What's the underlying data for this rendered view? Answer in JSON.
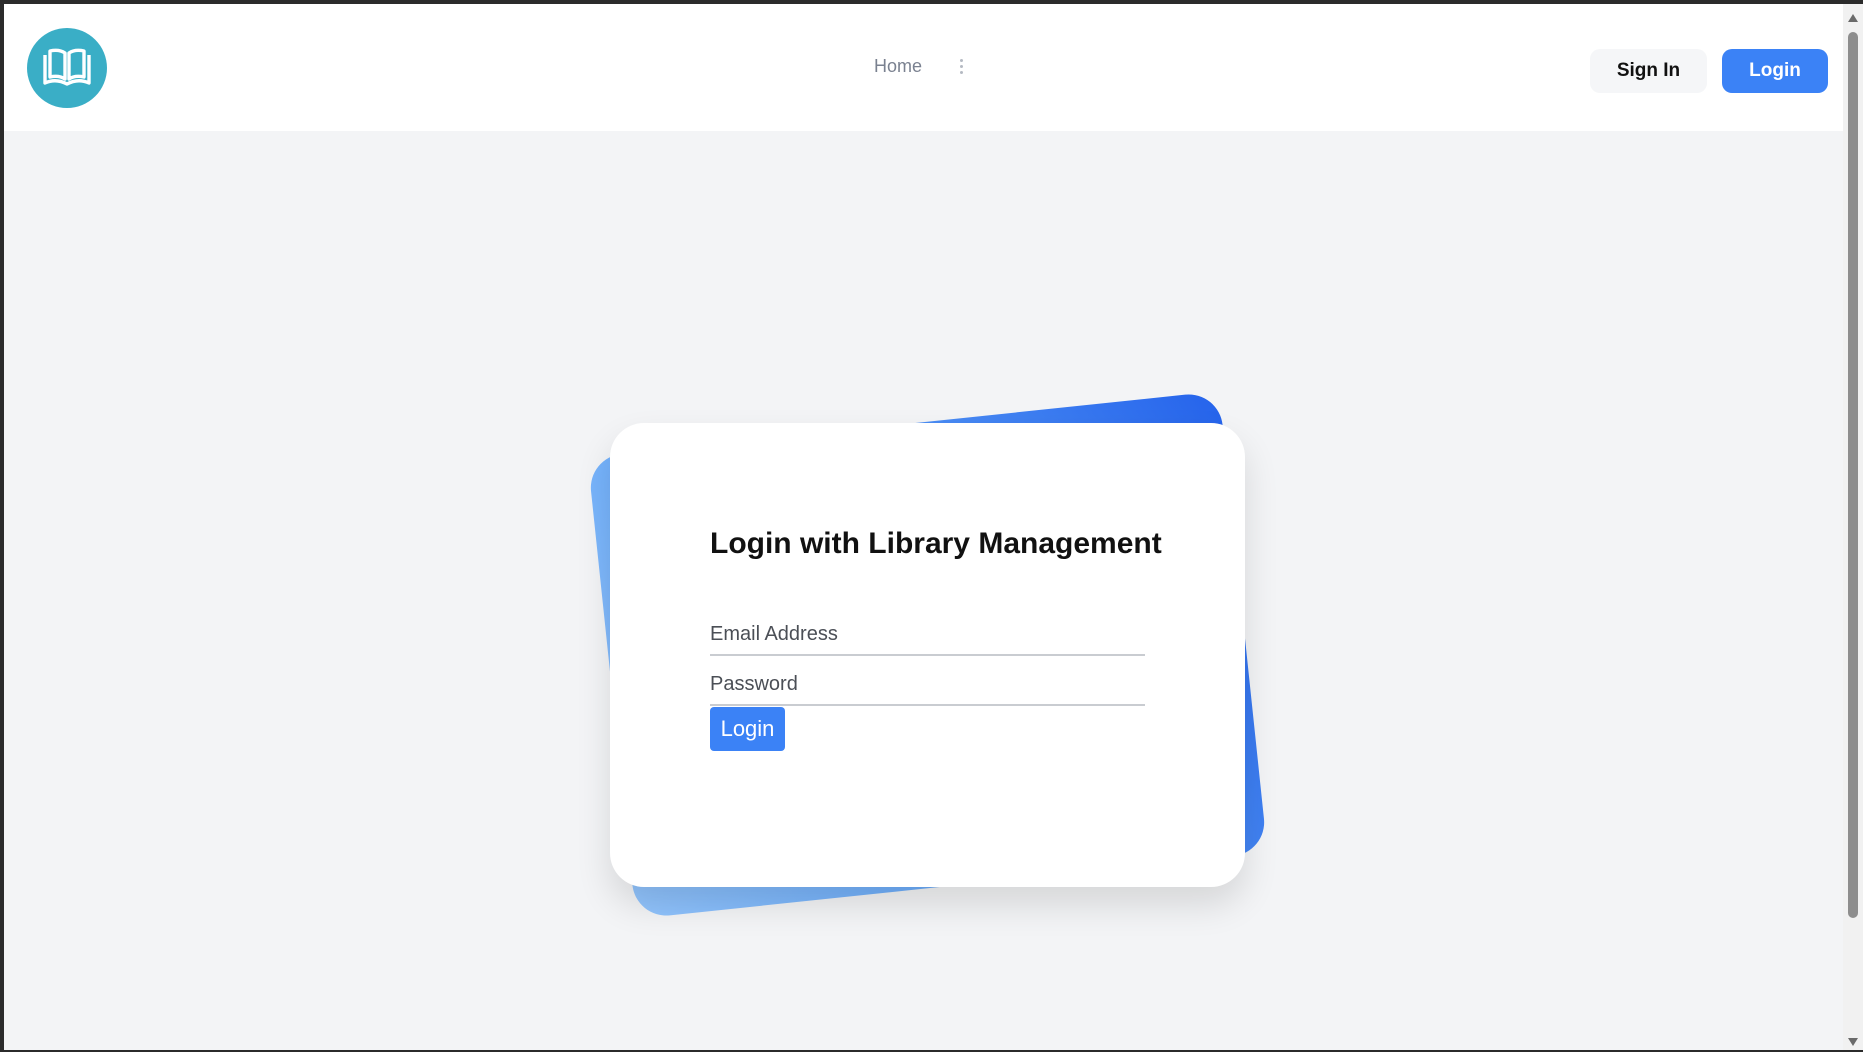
{
  "header": {
    "logo_icon": "open-book-icon",
    "nav": {
      "home_label": "Home",
      "more_icon": "vertical-dots-icon"
    },
    "sign_in_label": "Sign In",
    "login_label": "Login"
  },
  "login_card": {
    "title": "Login with Library Management",
    "email_placeholder": "Email Address",
    "email_value": "",
    "password_placeholder": "Password",
    "password_value": "",
    "submit_label": "Login"
  },
  "colors": {
    "logo_bg": "#3aaec6",
    "primary": "#3b82f6",
    "page_bg": "#f3f4f6",
    "card_accent_start": "#93c5fd",
    "card_accent_end": "#2563eb"
  }
}
